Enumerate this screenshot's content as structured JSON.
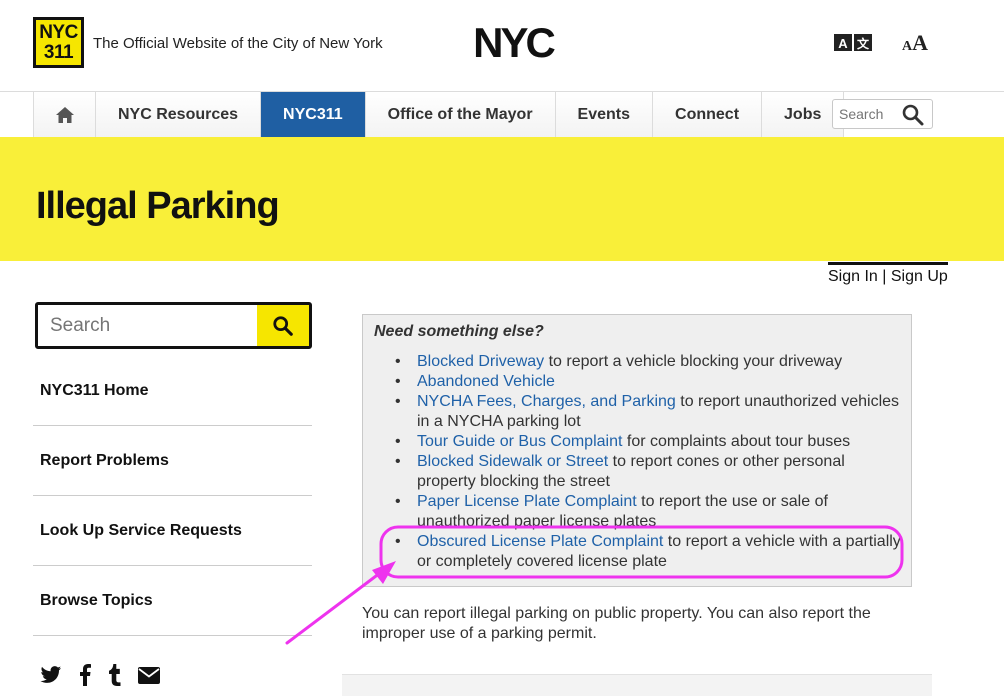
{
  "header": {
    "logo_line1": "NYC",
    "logo_line2": "311",
    "tagline": "The Official Website of the City of New York",
    "brand_logo_text": "NYC",
    "text_size_small": "A",
    "text_size_large": "A"
  },
  "nav": {
    "items": [
      {
        "label": "NYC Resources"
      },
      {
        "label": "NYC311"
      },
      {
        "label": "Office of the Mayor"
      },
      {
        "label": "Events"
      },
      {
        "label": "Connect"
      },
      {
        "label": "Jobs"
      }
    ],
    "search_placeholder": "Search"
  },
  "banner": {
    "title": "Illegal Parking"
  },
  "auth": {
    "sign_in": "Sign In",
    "separator": "|",
    "sign_up": "Sign Up"
  },
  "sidebar": {
    "search_placeholder": "Search",
    "links": [
      {
        "label": "NYC311 Home"
      },
      {
        "label": "Report Problems"
      },
      {
        "label": "Look Up Service Requests"
      },
      {
        "label": "Browse Topics"
      }
    ],
    "social_icons": [
      "twitter-icon",
      "facebook-icon",
      "tumblr-icon",
      "email-icon"
    ]
  },
  "related": {
    "heading": "Need something else?",
    "items": [
      {
        "link": "Blocked Driveway",
        "text": " to report a vehicle blocking your driveway"
      },
      {
        "link": "Abandoned Vehicle",
        "text": ""
      },
      {
        "link": "NYCHA Fees, Charges, and Parking",
        "text": " to report unauthorized vehicles in a NYCHA parking lot"
      },
      {
        "link": "Tour Guide or Bus Complaint",
        "text": " for complaints about tour buses"
      },
      {
        "link": "Blocked Sidewalk or Street",
        "text": " to report cones or other personal property blocking the street"
      },
      {
        "link": "Paper License Plate Complaint",
        "text": " to report the use or sale of unauthorized paper license plates"
      },
      {
        "link": "Obscured License Plate Complaint",
        "text": " to report a vehicle with a partially or completely covered license plate"
      }
    ]
  },
  "body_text": "You can report illegal parking on public property. You can also report the improper use of a parking permit.",
  "colors": {
    "accent_yellow": "#f9ef39",
    "nav_active": "#1f5fa3",
    "link_blue": "#1f61a8",
    "annotation_magenta": "#ee33ee"
  }
}
